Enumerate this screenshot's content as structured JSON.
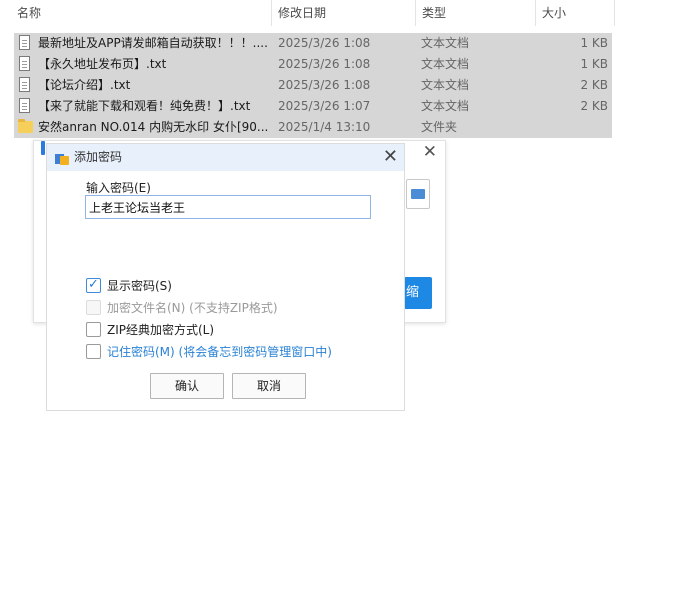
{
  "columns": {
    "name": "名称",
    "date": "修改日期",
    "type": "类型",
    "size": "大小"
  },
  "files": [
    {
      "name": "最新地址及APP请发邮箱自动获取！！！....",
      "date": "2025/3/26 1:08",
      "type": "文本文档",
      "size": "1 KB",
      "icon": "text-file-icon"
    },
    {
      "name": "【永久地址发布页】.txt",
      "date": "2025/3/26 1:08",
      "type": "文本文档",
      "size": "1 KB",
      "icon": "text-file-icon"
    },
    {
      "name": "【论坛介绍】.txt",
      "date": "2025/3/26 1:08",
      "type": "文本文档",
      "size": "2 KB",
      "icon": "text-file-icon"
    },
    {
      "name": "【来了就能下载和观看！纯免费！】.txt",
      "date": "2025/3/26 1:07",
      "type": "文本文档",
      "size": "2 KB",
      "icon": "text-file-icon"
    },
    {
      "name": "安然anran NO.014 内购无水印 女仆[90...",
      "date": "2025/1/4 13:10",
      "type": "文件夹",
      "size": "",
      "icon": "folder-icon"
    }
  ],
  "back_dialog": {
    "zip_button_label": "缩"
  },
  "dialog": {
    "title": "添加密码",
    "password_label": "输入密码(E)",
    "password_value": "上老王论坛当老王",
    "options": {
      "show_password": "显示密码(S)",
      "encrypt_filenames": "加密文件名(N) (不支持ZIP格式)",
      "zip_classic": "ZIP经典加密方式(L)",
      "remember_password": "记住密码(M) (将会备忘到密码管理窗口中)"
    },
    "ok_label": "确认",
    "cancel_label": "取消"
  },
  "colors": {
    "accent": "#1e88e5",
    "selected_row": "#d6d6d6",
    "titlebar": "#e8f1fb",
    "link": "#2a82d4"
  }
}
